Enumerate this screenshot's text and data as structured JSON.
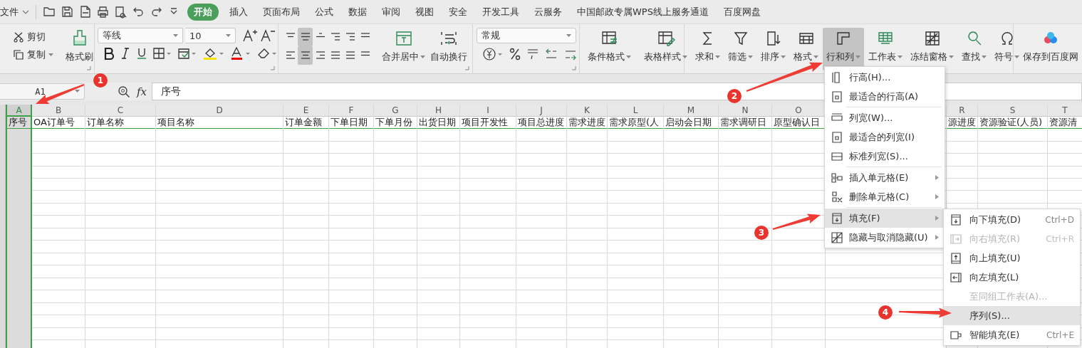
{
  "title_bar": {
    "file_menu": "文件"
  },
  "tabs": [
    {
      "label": "开始",
      "selected": true
    },
    {
      "label": "插入",
      "selected": false
    },
    {
      "label": "页面布局",
      "selected": false
    },
    {
      "label": "公式",
      "selected": false
    },
    {
      "label": "数据",
      "selected": false
    },
    {
      "label": "审阅",
      "selected": false
    },
    {
      "label": "视图",
      "selected": false
    },
    {
      "label": "安全",
      "selected": false
    },
    {
      "label": "开发工具",
      "selected": false
    },
    {
      "label": "云服务",
      "selected": false
    },
    {
      "label": "中国邮政专属WPS线上服务通道",
      "selected": false
    },
    {
      "label": "百度网盘",
      "selected": false
    }
  ],
  "ribbon": {
    "clipboard": {
      "cut": "剪切",
      "copy": "复制",
      "format_painter": "格式刷"
    },
    "font": {
      "family": "等线",
      "size": "10"
    },
    "alignment": {
      "buttons": [
        {
          "selected": false
        },
        {
          "selected": true
        },
        {
          "selected": false
        },
        {
          "selected": false
        },
        {
          "selected": false
        },
        {
          "selected": false
        },
        {
          "selected": false
        },
        {
          "selected": true
        },
        {
          "selected": false
        },
        {
          "selected": false
        },
        {
          "selected": false
        },
        {
          "selected": false
        }
      ],
      "merge": "合并居中",
      "wrap": "自动换行"
    },
    "number": {
      "format": "常规"
    },
    "styles": [
      "条件格式",
      "表格样式"
    ],
    "tools": [
      {
        "label": "求和",
        "selected": false
      },
      {
        "label": "筛选",
        "selected": false
      },
      {
        "label": "排序",
        "selected": false
      },
      {
        "label": "格式",
        "selected": false
      },
      {
        "label": "行和列",
        "selected": true
      },
      {
        "label": "工作表",
        "selected": false
      },
      {
        "label": "冻结窗格",
        "selected": false
      },
      {
        "label": "查找",
        "selected": false
      },
      {
        "label": "符号",
        "selected": false
      }
    ],
    "cloud": {
      "save": "保存到百度网"
    }
  },
  "formula_bar": {
    "cell": "A1",
    "fx": "fx",
    "value": "序号"
  },
  "sheet": {
    "columns": [
      {
        "letter": "A",
        "header": "序号",
        "selected": true
      },
      {
        "letter": "B",
        "header": "OA订单号",
        "selected": false
      },
      {
        "letter": "C",
        "header": "订单名称",
        "selected": false
      },
      {
        "letter": "D",
        "header": "项目名称",
        "selected": false
      },
      {
        "letter": "E",
        "header": "订单金额",
        "selected": false
      },
      {
        "letter": "F",
        "header": "下单日期",
        "selected": false
      },
      {
        "letter": "G",
        "header": "下单月份",
        "selected": false
      },
      {
        "letter": "H",
        "header": "出货日期",
        "selected": false
      },
      {
        "letter": "I",
        "header": "项目开发性",
        "selected": false
      },
      {
        "letter": "J",
        "header": "项目总进度",
        "selected": false
      },
      {
        "letter": "K",
        "header": "需求进度",
        "selected": false
      },
      {
        "letter": "L",
        "header": "需求原型(人",
        "selected": false
      },
      {
        "letter": "M",
        "header": "启动会日期",
        "selected": false
      },
      {
        "letter": "N",
        "header": "需求调研日",
        "selected": false
      },
      {
        "letter": "O",
        "header": "原型确认日",
        "selected": false
      },
      {
        "letter": "R",
        "header": "源进度",
        "selected": false
      },
      {
        "letter": "S",
        "header": "资源验证(人员)",
        "selected": false
      },
      {
        "letter": "T",
        "header": "资源清",
        "selected": false
      }
    ]
  },
  "context_menu": {
    "groups": [
      [
        {
          "label": "行高(H)...",
          "submenu": false,
          "selected": false
        },
        {
          "label": "最适合的行高(A)",
          "submenu": false,
          "selected": false
        }
      ],
      [
        {
          "label": "列宽(W)...",
          "submenu": false,
          "selected": false
        },
        {
          "label": "最适合的列宽(I)",
          "submenu": false,
          "selected": false
        },
        {
          "label": "标准列宽(S)...",
          "submenu": false,
          "selected": false
        }
      ],
      [
        {
          "label": "插入单元格(E)",
          "submenu": true,
          "selected": false
        },
        {
          "label": "删除单元格(C)",
          "submenu": true,
          "selected": false
        }
      ],
      [
        {
          "label": "填充(F)",
          "submenu": true,
          "selected": true
        },
        {
          "label": "隐藏与取消隐藏(U)",
          "submenu": true,
          "selected": false
        }
      ]
    ]
  },
  "submenu": {
    "items": [
      {
        "label": "向下填充(D)",
        "shortcut": "Ctrl+D",
        "disabled": false,
        "selected": false
      },
      {
        "label": "向右填充(R)",
        "shortcut": "Ctrl+R",
        "disabled": true,
        "selected": false
      },
      {
        "label": "向上填充(U)",
        "disabled": false,
        "selected": false
      },
      {
        "label": "向左填充(L)",
        "disabled": false,
        "selected": false
      },
      {
        "label": "至同组工作表(A)...",
        "disabled": true,
        "selected": false
      },
      {
        "label": "序列(S)...",
        "disabled": false,
        "selected": true
      },
      {
        "label": "智能填充(E)",
        "shortcut": "Ctrl+E",
        "disabled": false,
        "selected": false
      }
    ]
  },
  "annotations": [
    {
      "number": "1"
    },
    {
      "number": "2"
    },
    {
      "number": "3"
    },
    {
      "number": "4"
    }
  ]
}
